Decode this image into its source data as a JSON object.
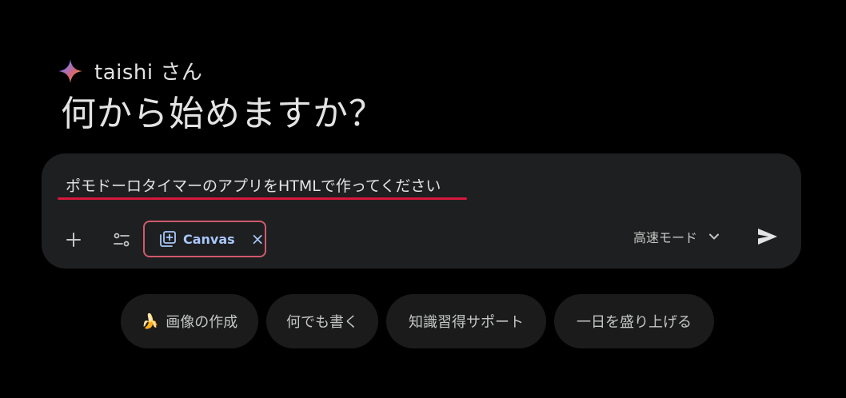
{
  "greeting": {
    "name": "taishi さん",
    "headline": "何から始めますか？"
  },
  "composer": {
    "prompt_text": "ポモドーロタイマーのアプリをHTMLで作ってください",
    "add_icon": "plus-icon",
    "tools_icon": "tune-icon",
    "canvas_chip": {
      "label": "Canvas",
      "close": "×",
      "icon": "canvas-icon"
    },
    "mode": {
      "selected": "高速モード",
      "icon": "chevron-down-icon"
    },
    "send_icon": "send-icon"
  },
  "suggestions": [
    {
      "label": "画像の作成",
      "icon": "banana-icon"
    },
    {
      "label": "何でも書く"
    },
    {
      "label": "知識習得サポート"
    },
    {
      "label": "一日を盛り上げる"
    }
  ],
  "colors": {
    "background": "#000000",
    "composer_bg": "#1e1f20",
    "accent_blue": "#a8c7fa",
    "underline_red": "#d6173c",
    "highlight_border": "#cf5a6c"
  }
}
